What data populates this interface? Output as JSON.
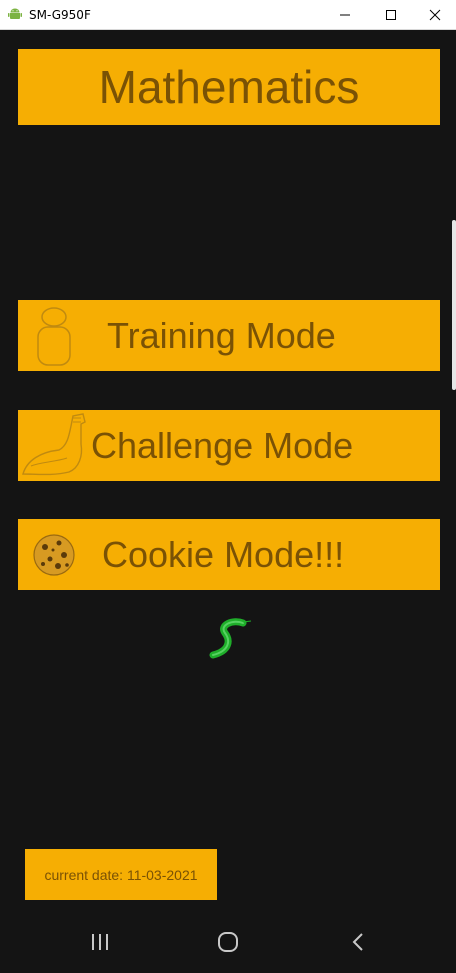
{
  "window": {
    "title": "SM-G950F",
    "controls": [
      "minimize",
      "maximize",
      "close"
    ]
  },
  "app": {
    "title": "Mathematics",
    "modes": [
      {
        "label": "Training Mode",
        "icon": "person-outline-icon"
      },
      {
        "label": "Challenge Mode",
        "icon": "flexed-arm-icon"
      },
      {
        "label": "Cookie Mode!!!",
        "icon": "cookie-icon"
      }
    ],
    "loader_icon": "green-worm-icon",
    "date_text": "current date: 11-03-2021"
  },
  "navbar": {
    "buttons": [
      "recent-apps",
      "home",
      "back"
    ]
  },
  "colors": {
    "accent": "#f6ae03",
    "text_on_accent": "#7a5205",
    "background": "#141414",
    "loader": "#1fae2a"
  }
}
